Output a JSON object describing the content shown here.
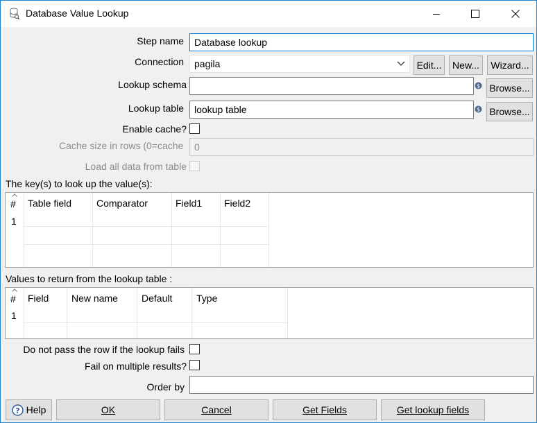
{
  "window": {
    "title": "Database Value Lookup",
    "icon": "database-lookup-icon",
    "accent": "#1883d7"
  },
  "form": {
    "step_name_label": "Step name",
    "step_name_value": "Database lookup",
    "connection_label": "Connection",
    "connection_value": "pagila",
    "edit_label": "Edit...",
    "new_label": "New...",
    "wizard_label": "Wizard...",
    "lookup_schema_label": "Lookup schema",
    "lookup_schema_value": "",
    "browse_label": "Browse...",
    "lookup_table_label": "Lookup table",
    "lookup_table_value": "lookup table",
    "enable_cache_label": "Enable cache?",
    "cache_size_label": "Cache size in rows (0=cache",
    "cache_size_value": "0",
    "load_all_label": "Load all data from table"
  },
  "keys_table": {
    "title": "The key(s) to look up the value(s):",
    "hash": "#",
    "columns": [
      "Table field",
      "Comparator",
      "Field1",
      "Field2"
    ],
    "rows": [
      "1"
    ]
  },
  "values_table": {
    "title": "Values to return from the lookup table :",
    "hash": "#",
    "columns": [
      "Field",
      "New name",
      "Default",
      "Type"
    ],
    "rows": [
      "1"
    ]
  },
  "options": {
    "no_pass_label": "Do not pass the row if the lookup fails",
    "fail_multiple_label": "Fail on multiple results?",
    "order_by_label": "Order by",
    "order_by_value": ""
  },
  "buttons": {
    "help": "Help",
    "ok": "OK",
    "cancel": "Cancel",
    "get_fields": "Get Fields",
    "get_lookup_fields": "Get lookup fields"
  }
}
